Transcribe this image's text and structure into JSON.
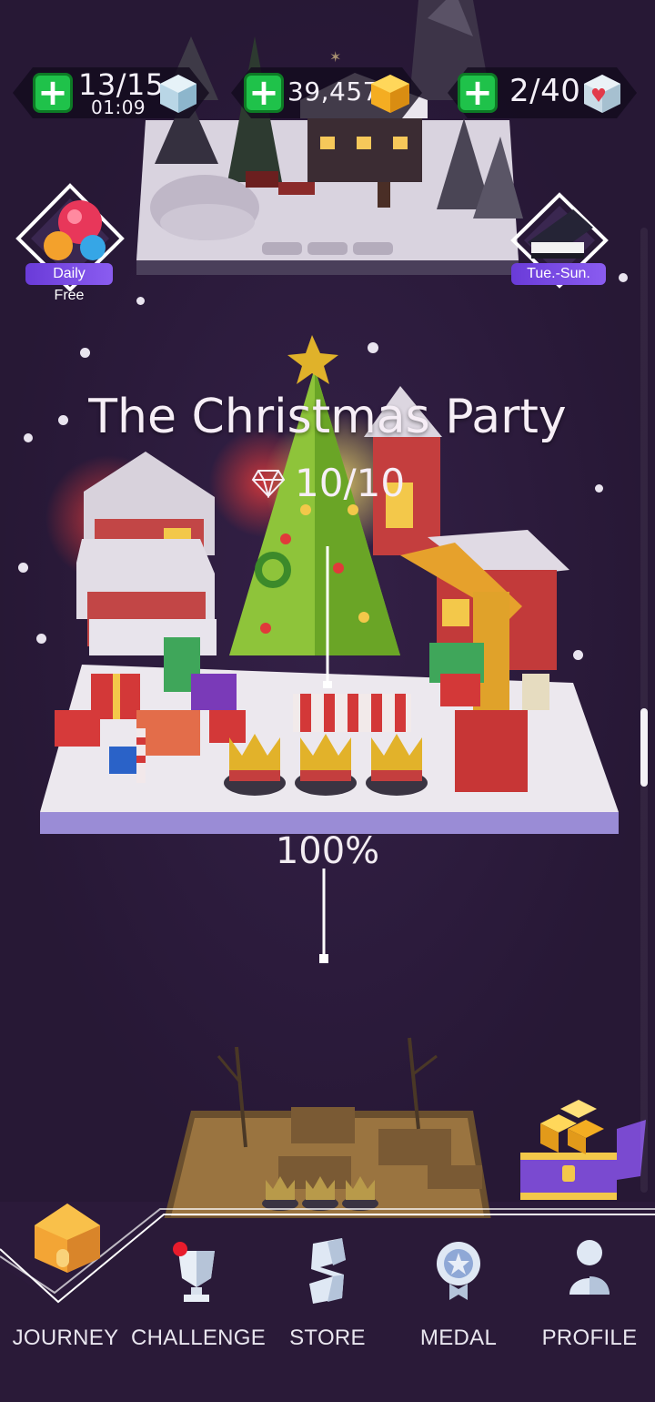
{
  "resources": {
    "gems": {
      "value": "13/15",
      "timer": "01:09",
      "icon": "diamond-cube-icon"
    },
    "coins": {
      "value": "39,457",
      "icon": "gold-cube-icon"
    },
    "hearts": {
      "value": "2/40",
      "icon": "heart-cube-icon"
    }
  },
  "badges": {
    "daily": {
      "label": "Daily Free",
      "icon": "gem-cluster-icon"
    },
    "piano": {
      "label": "Tue.-Sun.",
      "icon": "piano-icon"
    }
  },
  "level": {
    "title": "The Christmas Party",
    "gems": "10/10",
    "progress": "100%",
    "progress_value": 1.0
  },
  "nav": {
    "items": [
      {
        "id": "journey",
        "label": "JOURNEY",
        "icon": "house-icon",
        "active": true
      },
      {
        "id": "challenge",
        "label": "CHALLENGE",
        "icon": "trophy-icon",
        "notification": true
      },
      {
        "id": "store",
        "label": "STORE",
        "icon": "store-s-icon"
      },
      {
        "id": "medal",
        "label": "MEDAL",
        "icon": "medal-icon"
      },
      {
        "id": "profile",
        "label": "PROFILE",
        "icon": "profile-icon"
      }
    ]
  },
  "colors": {
    "background": "#2a1a38",
    "accent_green": "#1fc24a",
    "badge_purple": "#7b4ae6",
    "gold": "#f7b52a",
    "nav_active": "#f7a235"
  }
}
